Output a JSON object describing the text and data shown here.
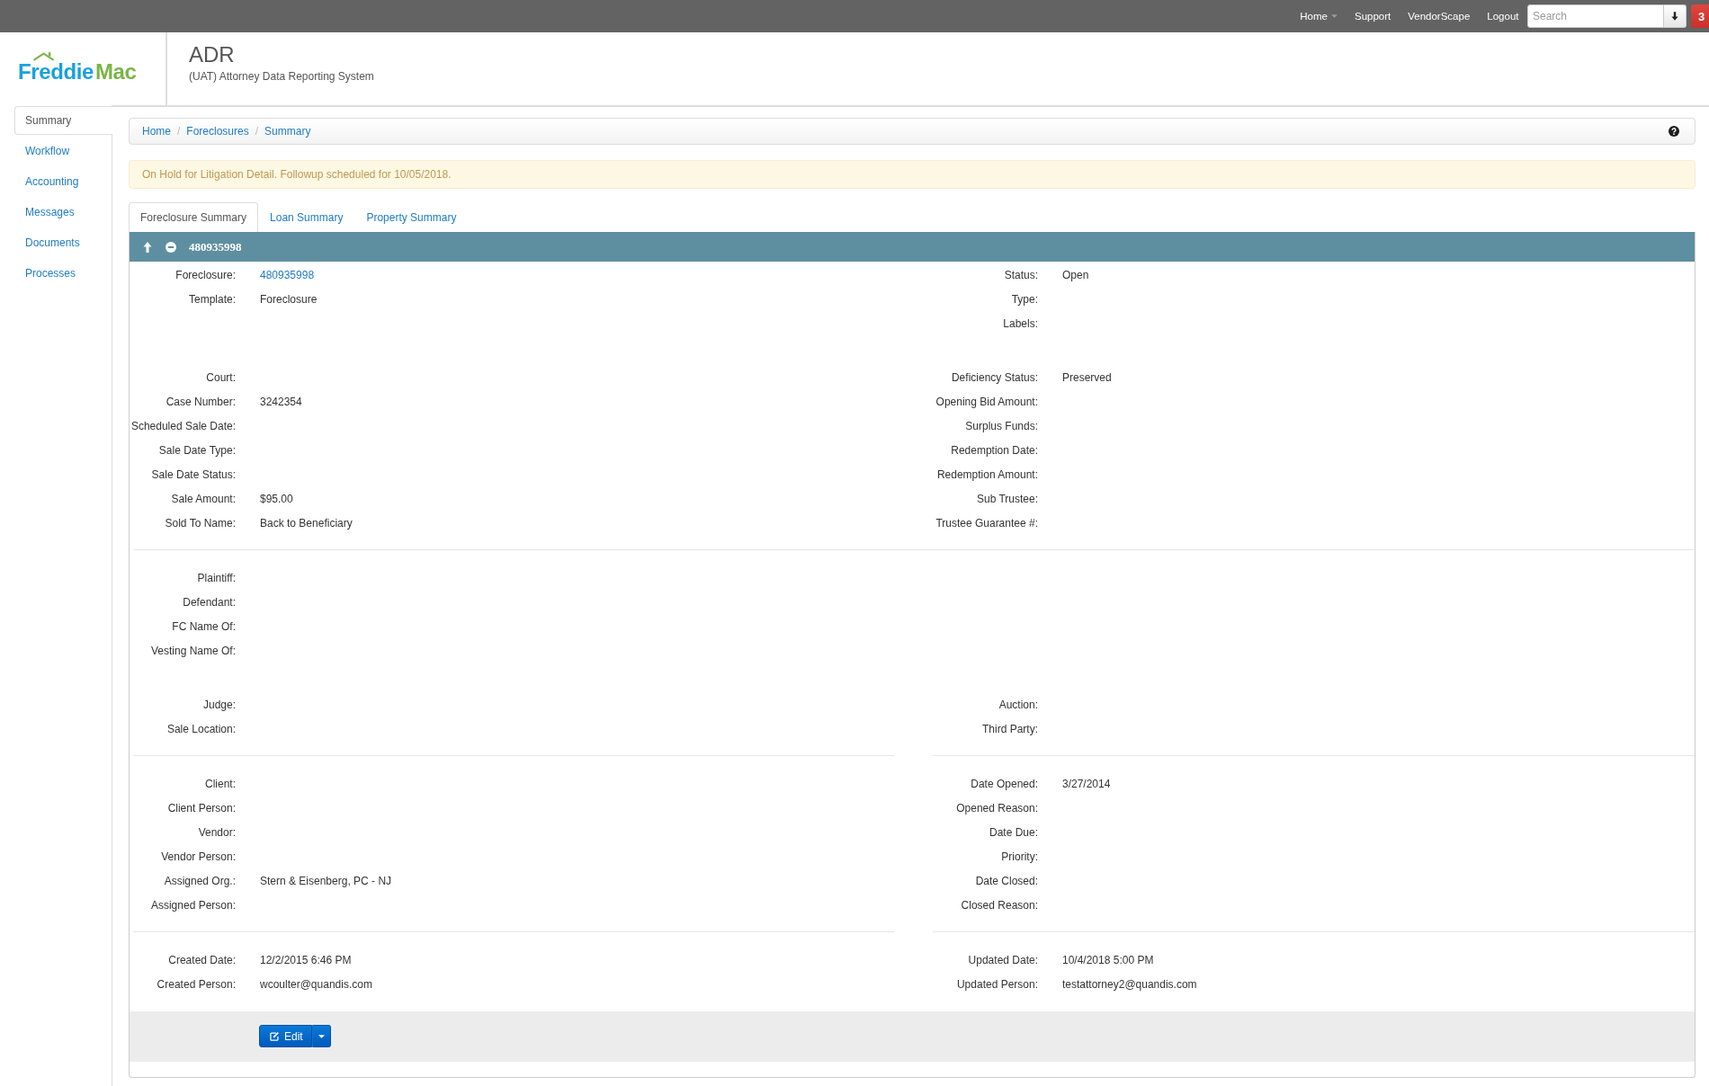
{
  "topnav": {
    "items": [
      {
        "label": "Home",
        "dropdown": true
      },
      {
        "label": "Support",
        "dropdown": false
      },
      {
        "label": "VendorScape",
        "dropdown": false
      },
      {
        "label": "Logout",
        "dropdown": false
      }
    ],
    "search": {
      "placeholder": "Search"
    },
    "badge": "3"
  },
  "header": {
    "logo": [
      "Freddie",
      "Mac"
    ],
    "title": "ADR",
    "subtitle": "(UAT) Attorney Data Reporting System"
  },
  "sidebar": {
    "items": [
      {
        "label": "Summary",
        "selected": true
      },
      {
        "label": "Workflow",
        "selected": false
      },
      {
        "label": "Accounting",
        "selected": false
      },
      {
        "label": "Messages",
        "selected": false
      },
      {
        "label": "Documents",
        "selected": false
      },
      {
        "label": "Processes",
        "selected": false
      }
    ]
  },
  "breadcrumb": {
    "items": [
      "Home",
      "Foreclosures",
      "Summary"
    ],
    "separator": "/"
  },
  "alert": {
    "text": "On Hold for Litigation Detail. Followup scheduled for 10/05/2018."
  },
  "tabs": [
    {
      "label": "Foreclosure Summary",
      "selected": true
    },
    {
      "label": "Loan Summary",
      "selected": false
    },
    {
      "label": "Property Summary",
      "selected": false
    }
  ],
  "panel": {
    "title": "480935998",
    "blocks": [
      {
        "kind": "fields",
        "left": [
          {
            "label": "Foreclosure:",
            "link": "480935998"
          },
          {
            "label": "Template:",
            "value": "Foreclosure"
          }
        ],
        "right": [
          {
            "label": "Status:",
            "value": "Open"
          },
          {
            "label": "Type:"
          },
          {
            "label": "Labels:"
          }
        ]
      },
      {
        "kind": "fields",
        "left": [
          {
            "label": "Court:"
          },
          {
            "label": "Case Number:",
            "value": "3242354"
          },
          {
            "label": "Scheduled Sale Date:"
          },
          {
            "label": "Sale Date Type:"
          },
          {
            "label": "Sale Date Status:"
          },
          {
            "label": "Sale Amount:",
            "value": "$95.00"
          },
          {
            "label": "Sold To Name:",
            "value": "Back to Beneficiary"
          }
        ],
        "right": [
          {
            "label": "Deficiency Status:",
            "value": "Preserved"
          },
          {
            "label": "Opening Bid Amount:"
          },
          {
            "label": "Surplus Funds:"
          },
          {
            "label": "Redemption Date:"
          },
          {
            "label": "Redemption Amount:"
          },
          {
            "label": "Sub Trustee:"
          },
          {
            "label": "Trustee Guarantee #:"
          }
        ]
      },
      {
        "kind": "divider"
      },
      {
        "kind": "fields",
        "left": [
          {
            "label": "Plaintiff:"
          },
          {
            "label": "Defendant:"
          },
          {
            "label": "FC Name Of:"
          },
          {
            "label": "Vesting Name Of:"
          }
        ]
      },
      {
        "kind": "fields",
        "left": [
          {
            "label": "Judge:"
          },
          {
            "label": "Sale Location:"
          }
        ],
        "right": [
          {
            "label": "Auction:"
          },
          {
            "label": "Third Party:"
          }
        ]
      },
      {
        "kind": "splitdivider"
      },
      {
        "kind": "fields",
        "left": [
          {
            "label": "Client:"
          },
          {
            "label": "Client Person:"
          },
          {
            "label": "Vendor:"
          },
          {
            "label": "Vendor Person:"
          },
          {
            "label": "Assigned Org.:",
            "value": "Stern & Eisenberg, PC - NJ"
          },
          {
            "label": "Assigned Person:"
          }
        ],
        "right": [
          {
            "label": "Date Opened:",
            "value": "3/27/2014"
          },
          {
            "label": "Opened Reason:"
          },
          {
            "label": "Date Due:"
          },
          {
            "label": "Priority:"
          },
          {
            "label": "Date Closed:"
          },
          {
            "label": "Closed Reason:"
          }
        ]
      },
      {
        "kind": "splitdivider"
      },
      {
        "kind": "fields",
        "left": [
          {
            "label": "Created Date:",
            "value": "12/2/2015 6:46 PM"
          },
          {
            "label": "Created Person:",
            "value": "wcoulter@quandis.com"
          }
        ],
        "right": [
          {
            "label": "Updated Date:",
            "value": "10/4/2018 5:00 PM"
          },
          {
            "label": "Updated Person:",
            "value": "testattorney2@quandis.com"
          }
        ]
      }
    ],
    "footer": {
      "edit_button": "Edit"
    }
  }
}
